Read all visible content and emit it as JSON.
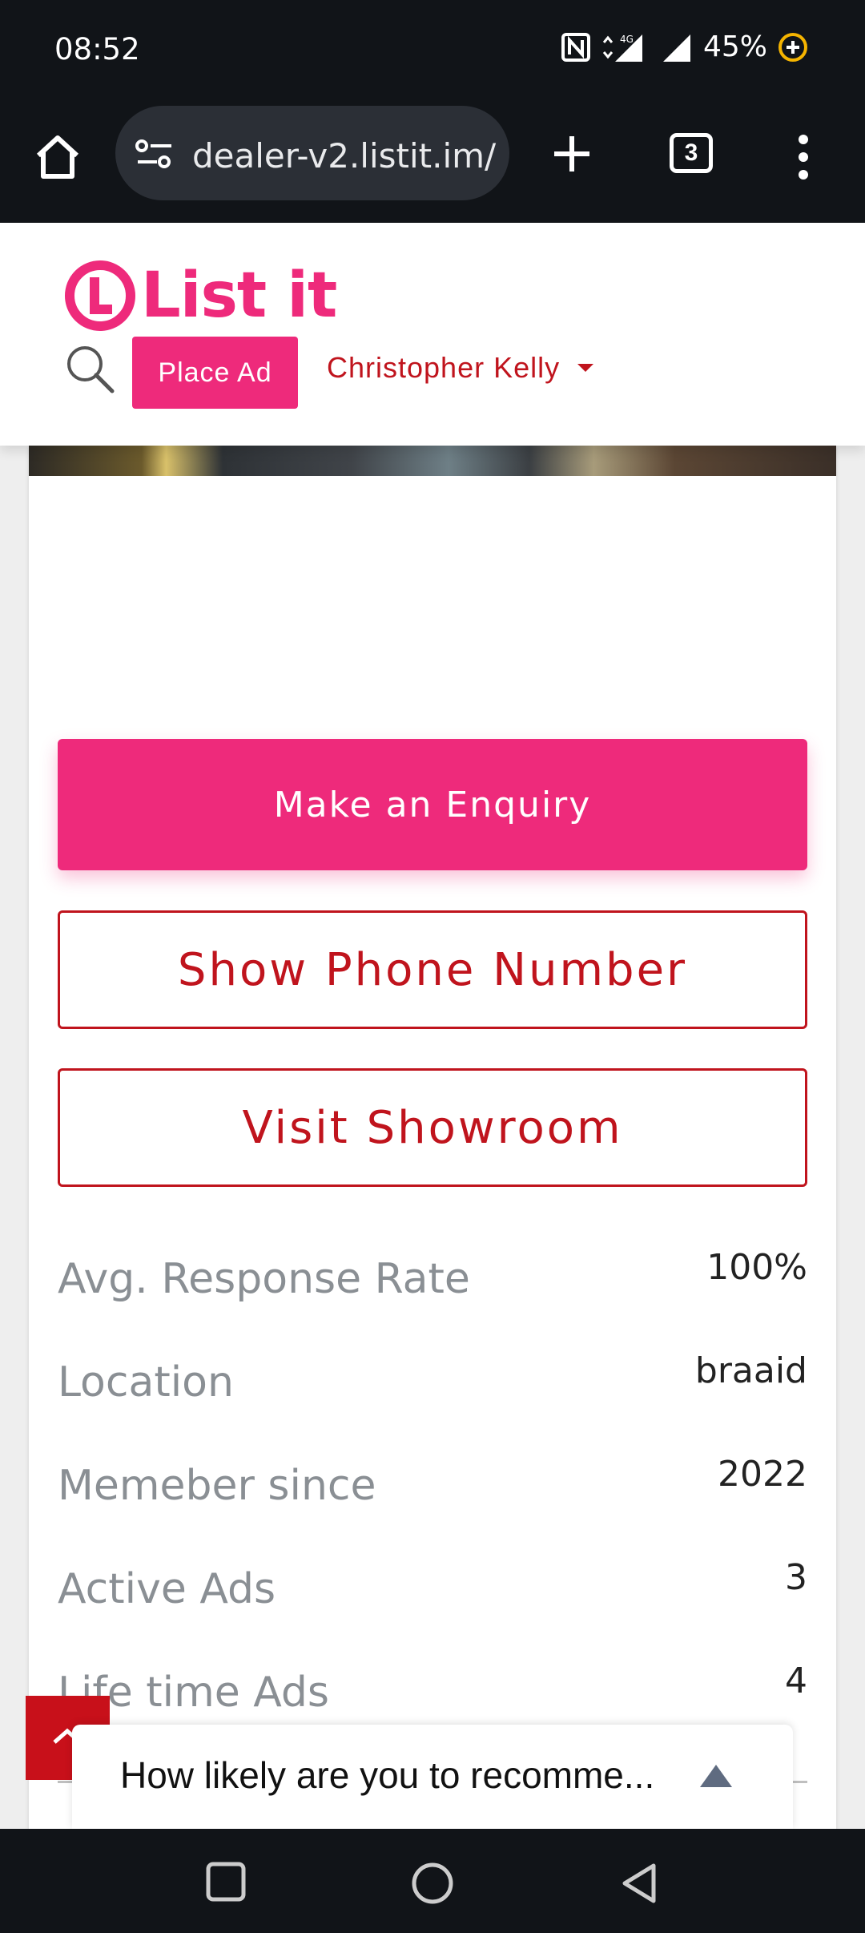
{
  "status_bar": {
    "time": "08:52",
    "network": "4G",
    "battery": "45%"
  },
  "browser": {
    "url": "dealer-v2.listit.im/",
    "tab_count": "3"
  },
  "header": {
    "logo_text": "List it",
    "place_ad_label": "Place Ad",
    "user_name": "Christopher Kelly"
  },
  "actions": {
    "enquiry_label": "Make an Enquiry",
    "phone_label": "Show Phone Number",
    "showroom_label": "Visit Showroom"
  },
  "stats": [
    {
      "label": "Avg. Response Rate",
      "value": "100%"
    },
    {
      "label": "Location",
      "value": "braaid"
    },
    {
      "label": "Memeber since",
      "value": "2022"
    },
    {
      "label": "Active Ads",
      "value": "3"
    },
    {
      "label": "Life time Ads",
      "value": "4"
    }
  ],
  "survey": {
    "question": "How likely are you to recomme..."
  },
  "colors": {
    "brand_pink": "#ee2a7b",
    "brand_red": "#c0141d"
  }
}
